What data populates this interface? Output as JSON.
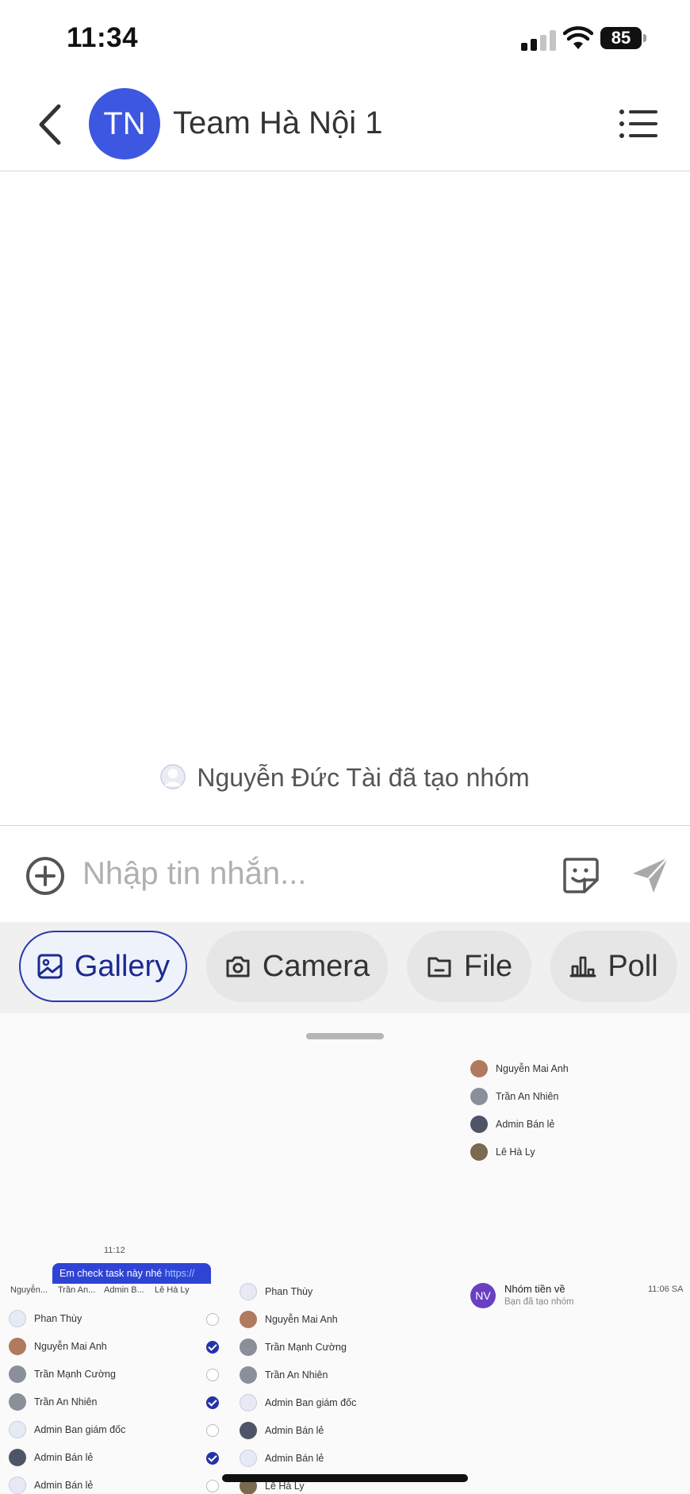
{
  "status_bar": {
    "time": "11:34",
    "battery_level": "85",
    "signal_bars_active": 2,
    "signal_bars_total": 4
  },
  "header": {
    "avatar_initials": "TN",
    "avatar_color": "#3d57e0",
    "title": "Team Hà Nội 1",
    "back_icon": "chevron-left-icon",
    "menu_icon": "list-icon"
  },
  "chat": {
    "system_message": "Nguyễn Đức Tài đã tạo nhóm"
  },
  "composer": {
    "placeholder": "Nhập tin nhắn...",
    "add_icon": "plus-circle-icon",
    "sticker_icon": "sticker-icon",
    "send_icon": "send-icon"
  },
  "attachments": {
    "gallery": "Gallery",
    "camera": "Camera",
    "file": "File",
    "poll": "Poll"
  },
  "gallery": {
    "thumb1": {
      "members": [
        "Nguyễn Mai Anh",
        "Trần An Nhiên",
        "Admin Bán lẻ",
        "Lê Hà Ly"
      ]
    },
    "thumb2": {
      "time": "11:12",
      "bubble_text": "Em check task này nhé ",
      "bubble_link": "https://",
      "top_labels": [
        "Nguyễn...",
        "Trần An...",
        "Admin B...",
        "Lê Hà Ly"
      ],
      "members": [
        "Phan Thùy",
        "Nguyễn Mai Anh",
        "Trần Mạnh Cường",
        "Trần An Nhiên",
        "Admin Ban giám đốc",
        "Admin Bán lẻ",
        "Admin Bán lẻ"
      ],
      "checked": [
        false,
        true,
        false,
        true,
        false,
        true,
        false
      ]
    },
    "thumb3": {
      "members": [
        "Phan Thùy",
        "Nguyễn Mai Anh",
        "Trần Mạnh Cường",
        "Trần An Nhiên",
        "Admin Ban giám đốc",
        "Admin Bán lẻ",
        "Admin Bán lẻ",
        "Lê Hà Ly"
      ]
    },
    "thumb4": {
      "avatar_initials": "NV",
      "avatar_color": "#6a3fc4",
      "title": "Nhóm tiền về",
      "subtitle": "Bạn đã tạo nhóm",
      "time": "11:06 SA"
    }
  }
}
